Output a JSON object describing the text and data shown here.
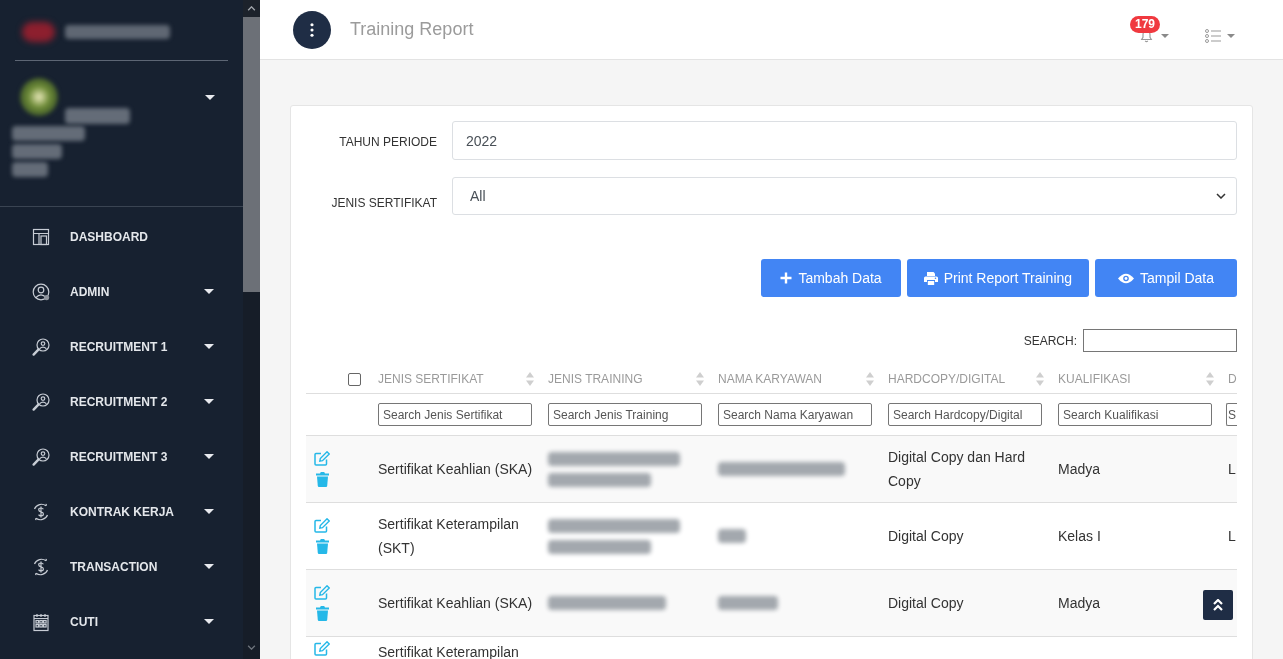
{
  "sidebar": {
    "menu": [
      {
        "label": "DASHBOARD",
        "has_submenu": false
      },
      {
        "label": "ADMIN",
        "has_submenu": true
      },
      {
        "label": "RECRUITMENT 1",
        "has_submenu": true
      },
      {
        "label": "RECRUITMENT 2",
        "has_submenu": true
      },
      {
        "label": "RECRUITMENT 3",
        "has_submenu": true
      },
      {
        "label": "KONTRAK KERJA",
        "has_submenu": true
      },
      {
        "label": "TRANSACTION",
        "has_submenu": true
      },
      {
        "label": "CUTI",
        "has_submenu": true
      }
    ]
  },
  "header": {
    "title": "Training Report",
    "notification_count": "179"
  },
  "filters": [
    {
      "kind": "input",
      "label": "TAHUN PERIODE",
      "value": "2022"
    },
    {
      "kind": "select",
      "label": "JENIS SERTIFIKAT",
      "value": "All"
    }
  ],
  "actions": [
    {
      "label": "Tambah Data"
    },
    {
      "label": "Print Report Training"
    },
    {
      "label": "Tampil Data"
    }
  ],
  "table": {
    "search_label": "SEARCH:",
    "select_all": {
      "checked": false
    },
    "columns": [
      {
        "label": "JENIS SERTIFIKAT",
        "search_placeholder": "Search Jenis Sertifikat"
      },
      {
        "label": "JENIS TRAINING",
        "search_placeholder": "Search Jenis Training"
      },
      {
        "label": "NAMA KARYAWAN",
        "search_placeholder": "Search Nama Karyawan"
      },
      {
        "label": "HARDCOPY/DIGITAL",
        "search_placeholder": "Search Hardcopy/Digital"
      },
      {
        "label": "KUALIFIKASI",
        "search_placeholder": "Search Kualifikasi"
      },
      {
        "label": "D",
        "search_placeholder": "S"
      }
    ],
    "rows": [
      {
        "cells": [
          {
            "kind": "text",
            "text": "Sertifikat Keahlian (SKA)"
          },
          {
            "kind": "blurred"
          },
          {
            "kind": "blurred"
          },
          {
            "kind": "text",
            "text": "Digital Copy dan Hard Copy"
          },
          {
            "kind": "text",
            "text": "Madya"
          },
          {
            "kind": "text",
            "text": "L"
          }
        ]
      },
      {
        "cells": [
          {
            "kind": "text",
            "text": "Sertifikat Keterampilan (SKT)"
          },
          {
            "kind": "blurred"
          },
          {
            "kind": "blurred"
          },
          {
            "kind": "text",
            "text": "Digital Copy"
          },
          {
            "kind": "text",
            "text": "Kelas I"
          },
          {
            "kind": "text",
            "text": "L"
          }
        ]
      },
      {
        "cells": [
          {
            "kind": "text",
            "text": "Sertifikat Keahlian (SKA)"
          },
          {
            "kind": "blurred"
          },
          {
            "kind": "blurred"
          },
          {
            "kind": "text",
            "text": "Digital Copy"
          },
          {
            "kind": "text",
            "text": "Madya"
          }
        ]
      },
      {
        "cells": [
          {
            "kind": "text",
            "text": "Sertifikat Keterampilan"
          }
        ]
      }
    ]
  }
}
